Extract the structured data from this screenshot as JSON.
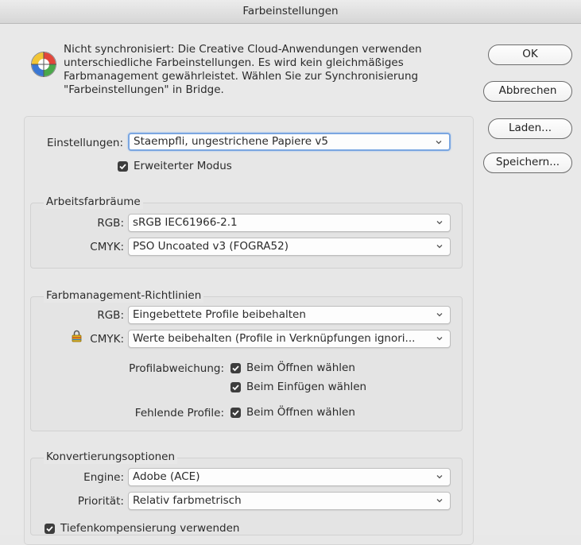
{
  "window": {
    "title": "Farbeinstellungen"
  },
  "info": {
    "icon": "color-sync-warning-icon",
    "lines": [
      "Nicht synchronisiert: Die Creative Cloud-Anwendungen verwenden",
      "unterschiedliche Farbeinstellungen. Es wird kein gleichmäßiges",
      "Farbmanagement gewährleistet. Wählen Sie zur Synchronisierung",
      "\"Farbeinstellungen\" in Bridge."
    ]
  },
  "buttons": {
    "ok": "OK",
    "cancel": "Abbrechen",
    "load": "Laden...",
    "save": "Speichern..."
  },
  "settings": {
    "label": "Einstellungen:",
    "value": "Staempfli, ungestrichene Papiere v5",
    "advanced_mode": {
      "label": "Erweiterter Modus",
      "checked": true
    }
  },
  "working_spaces": {
    "title": "Arbeitsfarbräume",
    "rgb": {
      "label": "RGB:",
      "value": "sRGB IEC61966-2.1"
    },
    "cmyk": {
      "label": "CMYK:",
      "value": "PSO Uncoated v3 (FOGRA52)"
    }
  },
  "policies": {
    "title": "Farbmanagement-Richtlinien",
    "rgb": {
      "label": "RGB:",
      "value": "Eingebettete Profile beibehalten"
    },
    "cmyk": {
      "label": "CMYK:",
      "value": "Werte beibehalten (Profile in Verknüpfungen ignori..."
    },
    "profile_mismatch": {
      "label": "Profilabweichung:",
      "ask_open": {
        "label": "Beim Öffnen wählen",
        "checked": true
      },
      "ask_paste": {
        "label": "Beim Einfügen wählen",
        "checked": true
      }
    },
    "missing_profiles": {
      "label": "Fehlende Profile:",
      "ask_open": {
        "label": "Beim Öffnen wählen",
        "checked": true
      }
    }
  },
  "conversion": {
    "title": "Konvertierungsoptionen",
    "engine": {
      "label": "Engine:",
      "value": "Adobe (ACE)"
    },
    "intent": {
      "label": "Priorität:",
      "value": "Relativ farbmetrisch"
    },
    "black_point": {
      "label": "Tiefenkompensierung verwenden",
      "checked": true
    }
  },
  "colors": {
    "checkbox": "#3d3d3d",
    "focus_ring": "#7aa6e1"
  }
}
